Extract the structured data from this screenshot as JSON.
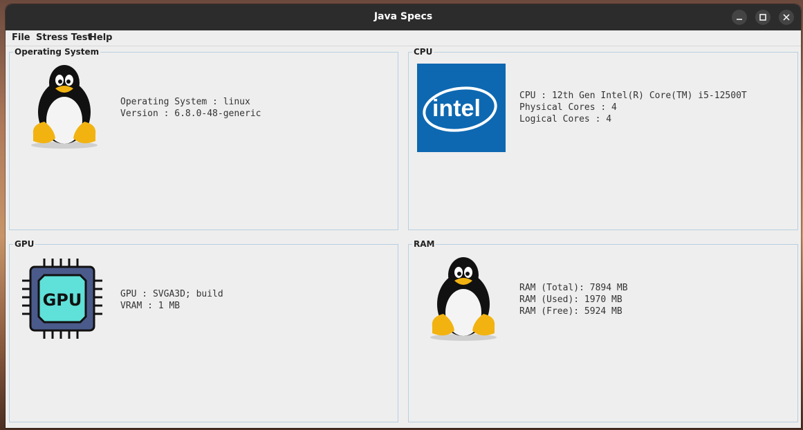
{
  "window": {
    "title": "Java Specs"
  },
  "menu": {
    "file": "File",
    "stress_test": "Stress Test",
    "help": "Help"
  },
  "os": {
    "title": "Operating System",
    "line1": "Operating System : linux",
    "line2": "Version : 6.8.0-48-generic",
    "icon": "linux-tux-icon"
  },
  "cpu": {
    "title": "CPU",
    "line1": "CPU : 12th Gen Intel(R) Core(TM) i5-12500T",
    "line2": "Physical Cores : 4",
    "line3": "Logical Cores : 4",
    "logo_text": "intel",
    "brand_color": "#0e68b1"
  },
  "gpu": {
    "title": "GPU",
    "line1": "GPU : SVGA3D; build",
    "line2": "VRAM : 1 MB",
    "chip_text": "GPU"
  },
  "ram": {
    "title": "RAM",
    "line1": "RAM (Total): 7894 MB",
    "line2": "RAM (Used): 1970 MB",
    "line3": "RAM (Free): 5924 MB",
    "icon": "linux-tux-icon"
  }
}
